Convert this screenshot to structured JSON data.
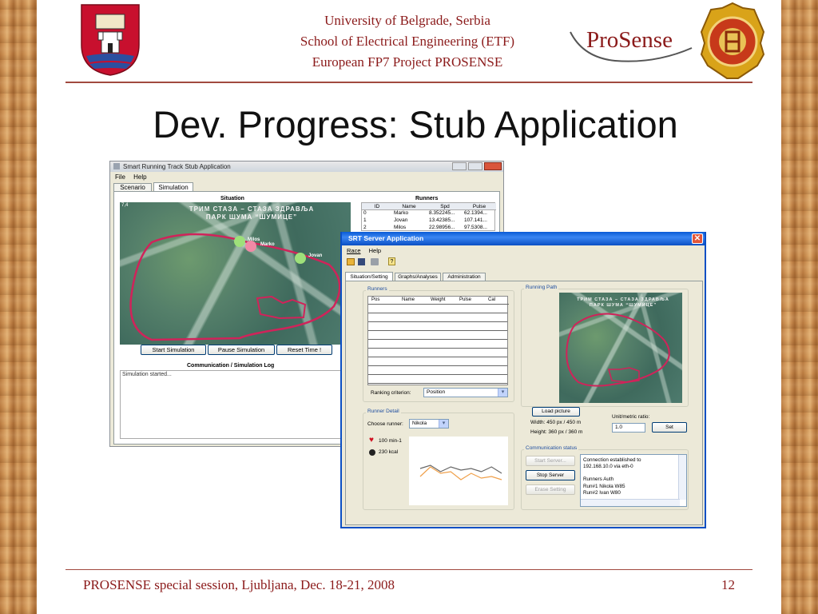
{
  "header": {
    "line1": "University of Belgrade, Serbia",
    "line2": "School of Electrical Engineering (ETF)",
    "line3": "European FP7 Project PROSENSE",
    "prosense_logo": "ProSense"
  },
  "slide_title": "Dev. Progress: Stub Application",
  "footer": {
    "left": "PROSENSE special session, Ljubljana, Dec. 18-21, 2008",
    "page": "12"
  },
  "stub_app": {
    "title": "Smart Running Track Stub Application",
    "menu": [
      "File",
      "Help"
    ],
    "tabs": [
      "Scenario",
      "Simulation"
    ],
    "active_tab": "Simulation",
    "situation_label": "Situation",
    "runners_label": "Runners",
    "map_text": {
      "line1": "ТРИМ СТАЗА – СТАЗА ЗДРАВЉА",
      "line2": "ПАРК ШУМА “ШУМИЦЕ”"
    },
    "map_corner": "7,4",
    "runner_markers": [
      "Milos",
      "Marko",
      "Jovan"
    ],
    "runners_table": {
      "columns": [
        "ID",
        "Name",
        "Spd",
        "Pulse"
      ],
      "rows": [
        [
          "0",
          "Marko",
          "8.352245...",
          "62.1394..."
        ],
        [
          "1",
          "Jovan",
          "13.42385...",
          "107.141..."
        ],
        [
          "2",
          "Milos",
          "22.98956...",
          "97.5308..."
        ]
      ]
    },
    "buttons": {
      "start": "Start Simulation",
      "pause": "Pause Simulation",
      "reset": "Reset Time !"
    },
    "log_label": "Communication / Simulation Log",
    "log_text": "Simulation started..."
  },
  "srt_app": {
    "title": "SRT Server Application",
    "menu": [
      "Race",
      "Help"
    ],
    "tabs": [
      "Situation/Setting",
      "Graphs/Analyses",
      "Administration"
    ],
    "active_tab": "Situation/Setting",
    "runners_group": "Runners",
    "runners_columns": [
      "Pos",
      "Name",
      "Weight",
      "Pulse",
      "Cal"
    ],
    "ranking_label": "Ranking criterion:",
    "ranking_value": "Position",
    "running_path_group": "Running Path",
    "map_text": {
      "line1": "ТРИМ СТАЗА – СТАЗА ЗДРАВЉА",
      "line2": "ПАРК ШУМА “ШУМИЦЕ”"
    },
    "load_picture": "Load picture",
    "width_text": "Width: 450 px / 450 m",
    "height_text": "Height: 360 px / 360 m",
    "unit_label": "Unit/metric ratio:",
    "unit_value": "1.0",
    "set_button": "Set",
    "runner_detail_group": "Runner Detail",
    "choose_runner_label": "Choose runner:",
    "choose_runner_value": "Nikola",
    "pulse_text": "100 min-1",
    "kcal_text": "230 kcal",
    "comm_group": "Communication status",
    "start_server": "Start Server...",
    "stop_server": "Stop Server",
    "erase_setting": "Erase Setting",
    "comm_log": [
      "Connection established to",
      "192.168.10.0 via eth-0",
      "",
      "Runners Auth",
      "Run#1 Nikola W85",
      "Run#2 Ivan W80"
    ],
    "chart_series": {
      "dark": [
        0.45,
        0.55,
        0.35,
        0.5,
        0.4,
        0.45,
        0.35,
        0.5,
        0.3
      ],
      "orange": [
        0.2,
        0.5,
        0.3,
        0.35,
        0.1,
        0.3,
        0.15,
        0.2,
        0.1
      ]
    },
    "colors": {
      "dark": "#666666",
      "orange": "#f0a04a",
      "track": "#d0235a",
      "marker": "#9ee07a"
    }
  }
}
